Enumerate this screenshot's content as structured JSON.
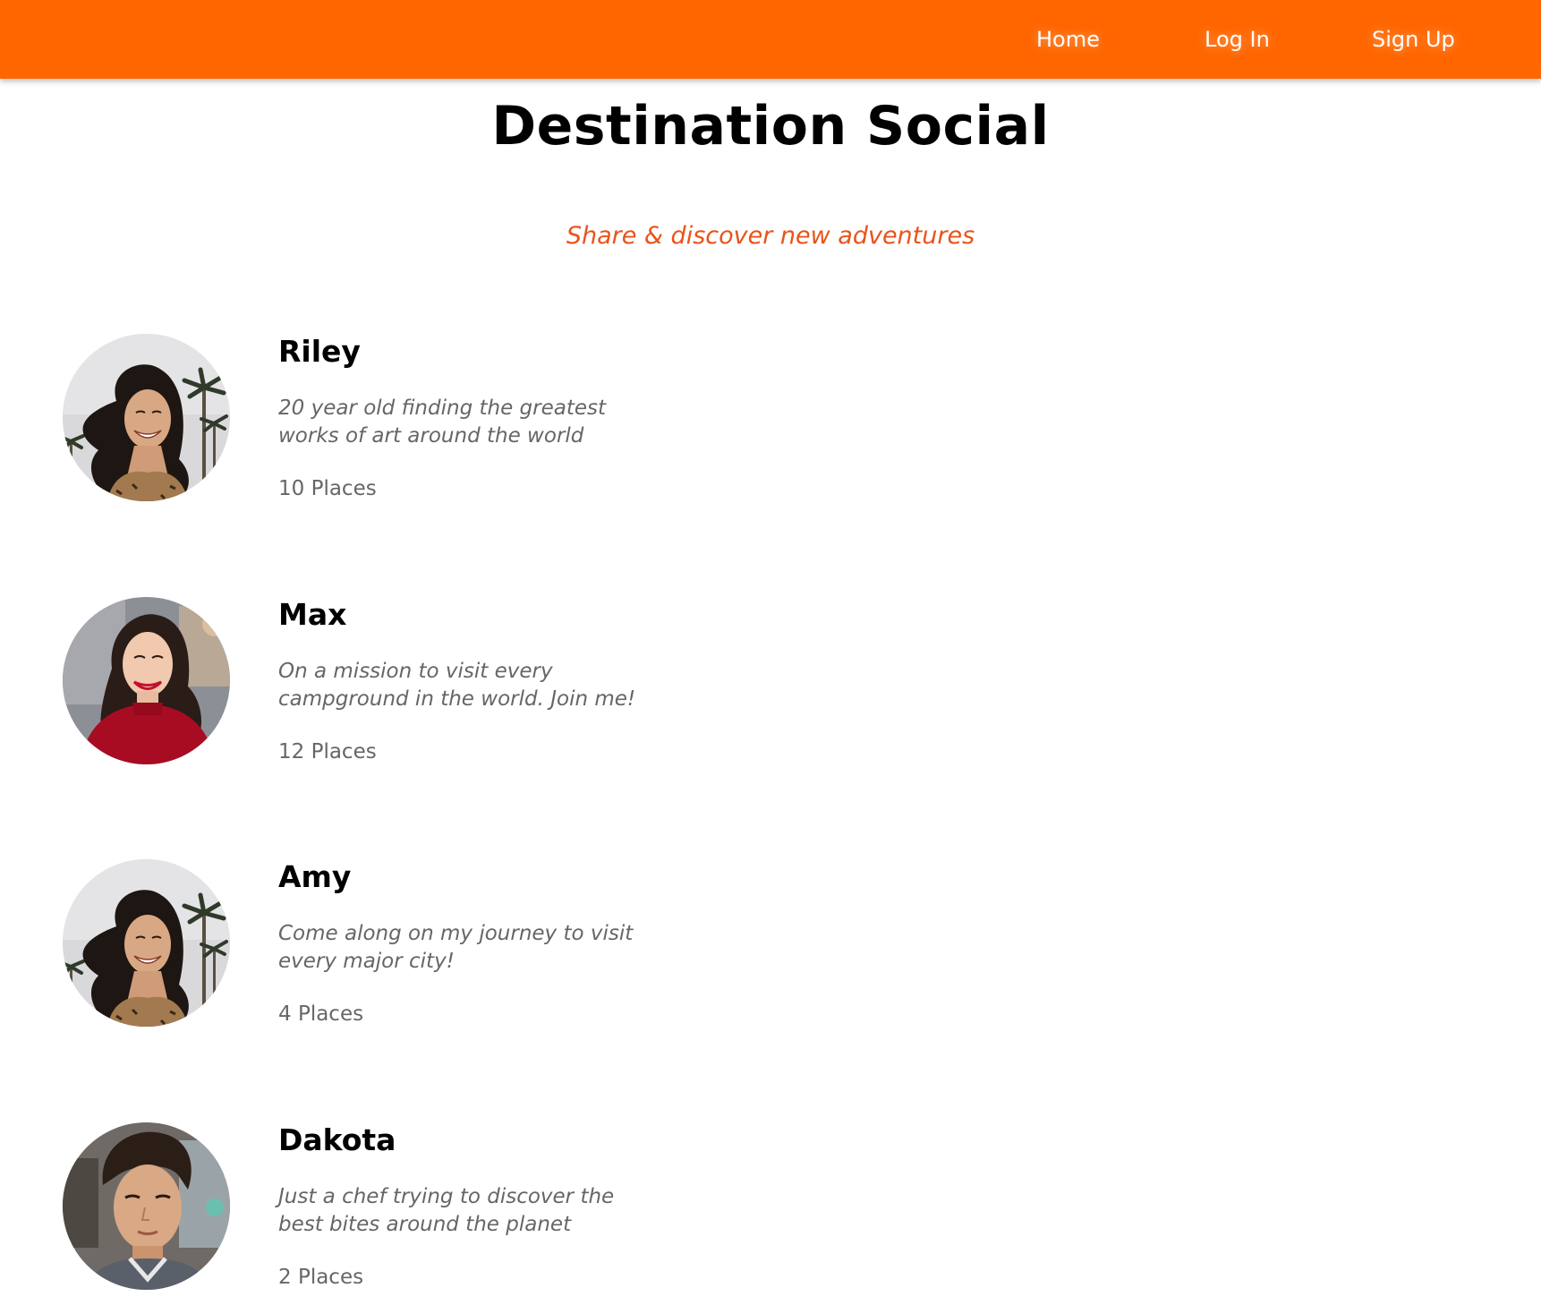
{
  "nav": {
    "home": "Home",
    "login": "Log In",
    "signup": "Sign Up",
    "bar_color": "#ff6600"
  },
  "header": {
    "title": "Destination Social",
    "tagline": "Share & discover new adventures",
    "tagline_color": "#e8541a"
  },
  "users": [
    {
      "name": "Riley",
      "bio": "20 year old finding the greatest works of art around the world",
      "places": "10 Places",
      "avatar": "woman-palm-trees-photo"
    },
    {
      "name": "Max",
      "bio": "On a mission to visit every campground in the world. Join me!",
      "places": "12 Places",
      "avatar": "woman-red-sweater-photo"
    },
    {
      "name": "Amy",
      "bio": "Come along on my journey to visit every major city!",
      "places": "4 Places",
      "avatar": "woman-palm-trees-photo"
    },
    {
      "name": "Dakota",
      "bio": "Just a chef trying to discover the best bites around the planet",
      "places": "2 Places",
      "avatar": "man-portrait-photo"
    }
  ]
}
